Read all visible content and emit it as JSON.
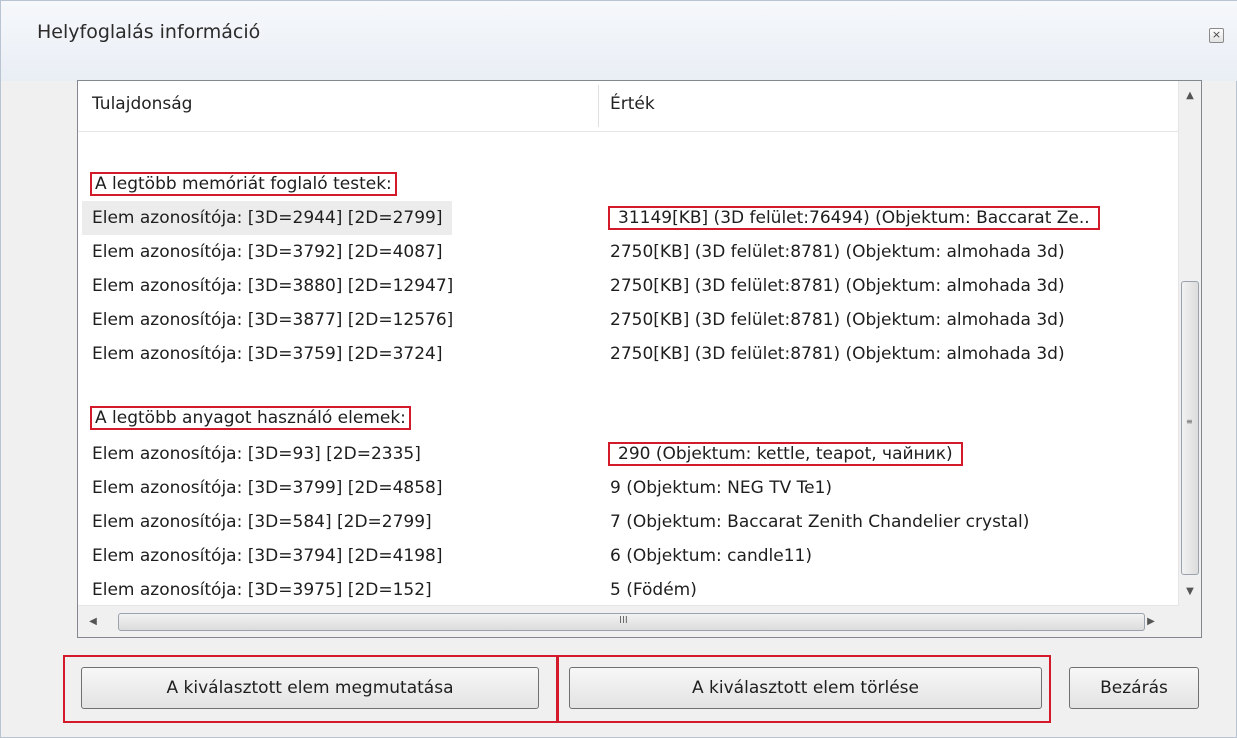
{
  "window": {
    "title": "Helyfoglalás információ",
    "close_icon": "close-icon"
  },
  "table": {
    "headers": {
      "property": "Tulajdonság",
      "value": "Érték"
    },
    "sections": [
      {
        "heading": "A legtöbb memóriát foglaló testek:",
        "rows": [
          {
            "property": "Elem azonosítója: [3D=2944] [2D=2799]",
            "value": "31149[KB] (3D felület:76494) (Objektum: Baccarat Ze.."
          },
          {
            "property": "Elem azonosítója: [3D=3792] [2D=4087]",
            "value": "2750[KB] (3D felület:8781) (Objektum: almohada 3d)"
          },
          {
            "property": "Elem azonosítója: [3D=3880] [2D=12947]",
            "value": "2750[KB] (3D felület:8781) (Objektum: almohada 3d)"
          },
          {
            "property": "Elem azonosítója: [3D=3877] [2D=12576]",
            "value": "2750[KB] (3D felület:8781) (Objektum: almohada 3d)"
          },
          {
            "property": "Elem azonosítója: [3D=3759] [2D=3724]",
            "value": "2750[KB] (3D felület:8781) (Objektum: almohada 3d)"
          }
        ]
      },
      {
        "heading": "A legtöbb anyagot használó elemek:",
        "rows": [
          {
            "property": "Elem azonosítója: [3D=93] [2D=2335]",
            "value": "290 (Objektum: kettle, teapot, чайник)"
          },
          {
            "property": "Elem azonosítója: [3D=3799] [2D=4858]",
            "value": "9 (Objektum: NEG TV Te1)"
          },
          {
            "property": "Elem azonosítója: [3D=584] [2D=2799]",
            "value": "7 (Objektum: Baccarat Zenith Chandelier crystal)"
          },
          {
            "property": "Elem azonosítója: [3D=3794] [2D=4198]",
            "value": "6 (Objektum: candle11)"
          },
          {
            "property": "Elem azonosítója: [3D=3975] [2D=152]",
            "value": "5 (Födém)"
          }
        ]
      }
    ]
  },
  "buttons": {
    "show_selected": "A kiválasztott elem megmutatása",
    "delete_selected": "A kiválasztott elem törlése",
    "close": "Bezárás"
  },
  "scroll": {
    "up": "▲",
    "down": "▼",
    "left": "◀",
    "right": "▶",
    "h_grip": "III",
    "v_grip": "≡"
  },
  "colors": {
    "highlight_frame": "#d21a2a",
    "selected_row": "#ececec"
  }
}
